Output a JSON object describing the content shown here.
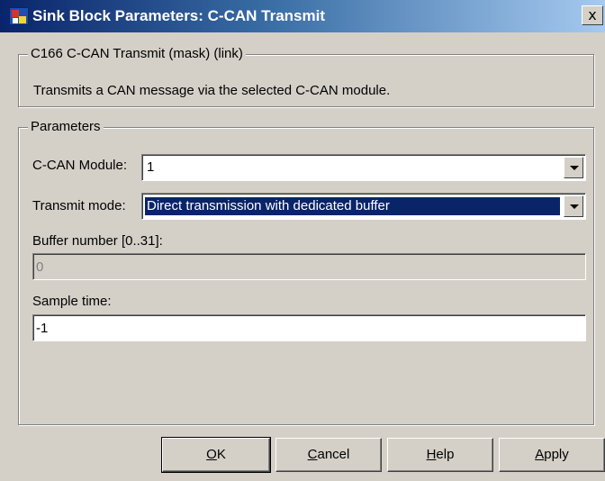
{
  "window": {
    "title": "Sink Block Parameters: C-CAN Transmit",
    "close_glyph": "x"
  },
  "description": {
    "legend": "C166 C-CAN Transmit (mask) (link)",
    "text": "Transmits a CAN message via the selected C-CAN module."
  },
  "parameters": {
    "legend": "Parameters",
    "ccan_module": {
      "label": "C-CAN Module:",
      "value": "1"
    },
    "transmit_mode": {
      "label": "Transmit mode:",
      "value": "Direct transmission with dedicated buffer"
    },
    "buffer_number": {
      "label": "Buffer number [0..31]:",
      "value": "0",
      "enabled": false
    },
    "sample_time": {
      "label": "Sample time:",
      "value": "-1"
    }
  },
  "buttons": {
    "ok": {
      "mnemonic": "O",
      "rest": "K"
    },
    "cancel": {
      "mnemonic": "C",
      "rest": "ancel"
    },
    "help": {
      "mnemonic": "H",
      "rest": "elp"
    },
    "apply": {
      "mnemonic": "A",
      "rest": "pply"
    }
  },
  "icons": {
    "app": "simulink-block-icon",
    "close": "close-icon",
    "dropdown": "chevron-down-icon"
  },
  "colors": {
    "titlebar_start": "#0a246a",
    "titlebar_end": "#a6caf0",
    "dialog_bg": "#d4d0c8",
    "selection": "#0a246a"
  }
}
